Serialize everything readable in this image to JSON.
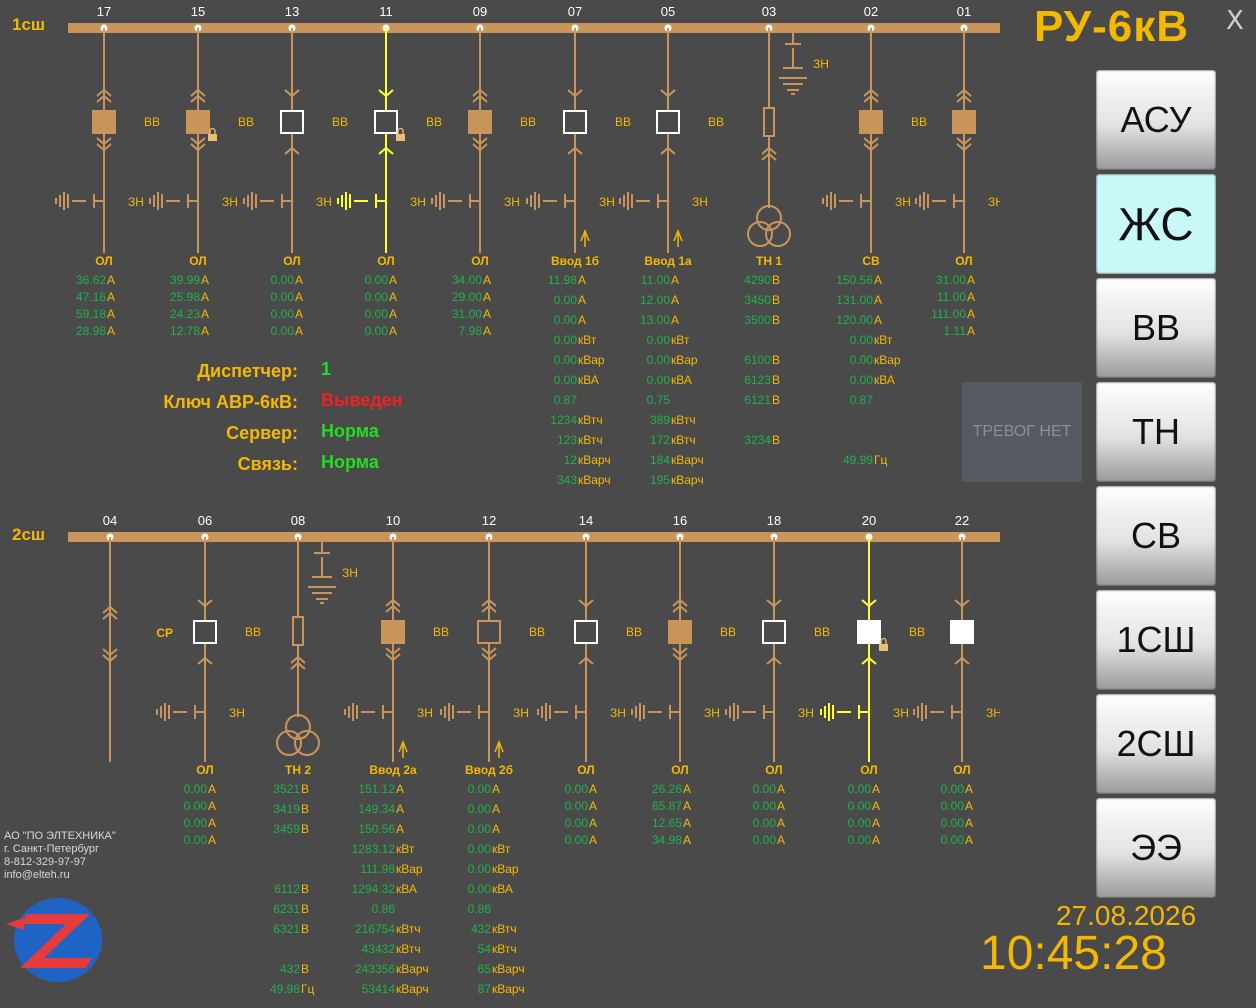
{
  "header": {
    "title": "РУ-6кВ",
    "close": "X"
  },
  "nav": [
    {
      "label": "АСУ",
      "active": false
    },
    {
      "label": "ЖС",
      "active": true
    },
    {
      "label": "ВВ",
      "active": false
    },
    {
      "label": "ТН",
      "active": false
    },
    {
      "label": "СВ",
      "active": false
    },
    {
      "label": "1СШ",
      "active": false
    },
    {
      "label": "2СШ",
      "active": false
    },
    {
      "label": "ЭЭ",
      "active": false
    }
  ],
  "alarm": "ТРЕВОГ НЕТ",
  "company": [
    "АО \"ПО ЭЛТЕХНИКА\"",
    "г. Санкт-Петербург",
    "8-812-329-97-97",
    "info@elteh.ru"
  ],
  "clock": {
    "date": "27.08.2026",
    "time": "10:45:28"
  },
  "status": [
    {
      "label": "Диспетчер:",
      "value": "1",
      "color": "#22dd22"
    },
    {
      "label": "Ключ АВР-6кВ:",
      "value": "Выведен",
      "color": "#ee2222"
    },
    {
      "label": "Сервер:",
      "value": "Норма",
      "color": "#22dd22"
    },
    {
      "label": "Связь:",
      "value": "Норма",
      "color": "#22dd22"
    }
  ],
  "bus1": {
    "label": "1сш",
    "cells": [
      {
        "num": "17",
        "type": "feeder",
        "breaker": "filled",
        "lock": false,
        "live": false,
        "name": "ОЛ",
        "values": [
          [
            "36.62",
            "А"
          ],
          [
            "47.16",
            "А"
          ],
          [
            "59.18",
            "А"
          ],
          [
            "28.98",
            "А"
          ]
        ]
      },
      {
        "num": "15",
        "type": "feeder",
        "breaker": "filled",
        "lock": true,
        "live": false,
        "name": "ОЛ",
        "values": [
          [
            "39.99",
            "А"
          ],
          [
            "25.98",
            "А"
          ],
          [
            "24.23",
            "А"
          ],
          [
            "12.78",
            "А"
          ]
        ]
      },
      {
        "num": "13",
        "type": "feeder",
        "breaker": "open",
        "lock": false,
        "live": false,
        "name": "ОЛ",
        "values": [
          [
            "0.00",
            "А"
          ],
          [
            "0.00",
            "А"
          ],
          [
            "0.00",
            "А"
          ],
          [
            "0.00",
            "А"
          ]
        ]
      },
      {
        "num": "11",
        "type": "feeder",
        "breaker": "open",
        "lock": true,
        "live": true,
        "name": "ОЛ",
        "values": [
          [
            "0.00",
            "А"
          ],
          [
            "0.00",
            "А"
          ],
          [
            "0.00",
            "А"
          ],
          [
            "0.00",
            "А"
          ]
        ]
      },
      {
        "num": "09",
        "type": "feeder",
        "breaker": "filled",
        "lock": false,
        "live": false,
        "name": "ОЛ",
        "values": [
          [
            "34.00",
            "А"
          ],
          [
            "29.00",
            "А"
          ],
          [
            "31.00",
            "А"
          ],
          [
            "7.98",
            "А"
          ]
        ]
      },
      {
        "num": "07",
        "type": "input",
        "breaker": "open",
        "lock": false,
        "live": false,
        "name": "Ввод 1б",
        "values": [
          [
            "11.98",
            "А"
          ],
          [
            "0.00",
            "А"
          ],
          [
            "0.00",
            "А"
          ],
          [
            "0.00",
            "кВт"
          ],
          [
            "0.00",
            "кВар"
          ],
          [
            "0.00",
            "кВА"
          ],
          [
            "0.87",
            ""
          ],
          [
            "1234",
            "кВтч"
          ],
          [
            "123",
            "кВтч"
          ],
          [
            "12",
            "кВарч"
          ],
          [
            "343",
            "кВарч"
          ]
        ]
      },
      {
        "num": "05",
        "type": "input",
        "breaker": "open",
        "lock": false,
        "live": false,
        "name": "Ввод 1а",
        "values": [
          [
            "11.00",
            "А"
          ],
          [
            "12.00",
            "А"
          ],
          [
            "13.00",
            "А"
          ],
          [
            "0.00",
            "кВт"
          ],
          [
            "0.00",
            "кВар"
          ],
          [
            "0.00",
            "кВА"
          ],
          [
            "0.75",
            "",
            true
          ],
          [
            "389",
            "кВтч"
          ],
          [
            "172",
            "кВтч"
          ],
          [
            "184",
            "кВарч"
          ],
          [
            "195",
            "кВарч"
          ]
        ]
      },
      {
        "num": "03",
        "type": "tn",
        "name": "ТН 1",
        "values": [
          [
            "4290",
            "В",
            "#ee3333"
          ],
          [
            "3450",
            "В"
          ],
          [
            "3500",
            "В"
          ],
          [
            "",
            ""
          ],
          [
            "6100",
            "В"
          ],
          [
            "6123",
            "В"
          ],
          [
            "6121",
            "В"
          ],
          [
            "",
            ""
          ],
          [
            "3234",
            "В",
            "#ee3333"
          ]
        ]
      },
      {
        "num": "02",
        "type": "sv",
        "breaker": "filled",
        "lock": false,
        "live": false,
        "name": "СВ",
        "values": [
          [
            "150.56",
            "А"
          ],
          [
            "131.00",
            "А"
          ],
          [
            "120.00",
            "А"
          ],
          [
            "0.00",
            "кВт"
          ],
          [
            "0.00",
            "кВар"
          ],
          [
            "0.00",
            "кВА"
          ],
          [
            "0.87",
            ""
          ],
          [
            "",
            ""
          ],
          [
            "",
            ""
          ],
          [
            "49.99",
            "Гц"
          ]
        ]
      },
      {
        "num": "01",
        "type": "feeder",
        "breaker": "filled",
        "lock": false,
        "live": false,
        "name": "ОЛ",
        "values": [
          [
            "31.00",
            "А"
          ],
          [
            "11.00",
            "А"
          ],
          [
            "111.00",
            "А"
          ],
          [
            "1.11",
            "А"
          ]
        ]
      }
    ]
  },
  "bus2": {
    "label": "2сш",
    "cells": [
      {
        "num": "04",
        "type": "cable",
        "name": "",
        "values": []
      },
      {
        "num": "06",
        "type": "feeder",
        "breaker": "open",
        "lock": false,
        "live": false,
        "name": "ОЛ",
        "extra": "СР",
        "values": [
          [
            "0.00",
            "А"
          ],
          [
            "0.00",
            "А"
          ],
          [
            "0.00",
            "А"
          ],
          [
            "0.00",
            "А"
          ]
        ]
      },
      {
        "num": "08",
        "type": "tn",
        "name": "ТН 2",
        "values": [
          [
            "3521",
            "В"
          ],
          [
            "3419",
            "В"
          ],
          [
            "3459",
            "В"
          ],
          [
            "",
            ""
          ],
          [
            "",
            ""
          ],
          [
            "6112",
            "В"
          ],
          [
            "6231",
            "В"
          ],
          [
            "6321",
            "В",
            "#dd22dd"
          ],
          [
            "",
            ""
          ],
          [
            "432",
            "В"
          ],
          [
            "49.98",
            "Гц"
          ]
        ]
      },
      {
        "num": "10",
        "type": "input",
        "breaker": "filled",
        "lock": false,
        "live": false,
        "name": "Ввод 2а",
        "values": [
          [
            "151.12",
            "А"
          ],
          [
            "149.34",
            "А"
          ],
          [
            "150.56",
            "А"
          ],
          [
            "1283.12",
            "кВт"
          ],
          [
            "111.98",
            "кВар"
          ],
          [
            "1294.32",
            "кВА"
          ],
          [
            "0.86",
            ""
          ],
          [
            "216754",
            "кВтч"
          ],
          [
            "43432",
            "кВтч"
          ],
          [
            "243356",
            "кВарч"
          ],
          [
            "53414",
            "кВарч"
          ]
        ]
      },
      {
        "num": "12",
        "type": "input",
        "breaker": "outline",
        "lock": false,
        "live": false,
        "name": "Ввод 2б",
        "values": [
          [
            "0.00",
            "А"
          ],
          [
            "0.00",
            "А"
          ],
          [
            "0.00",
            "А"
          ],
          [
            "0.00",
            "кВт"
          ],
          [
            "0.00",
            "кВар"
          ],
          [
            "0.00",
            "кВА"
          ],
          [
            "0.86",
            ""
          ],
          [
            "432",
            "кВтч"
          ],
          [
            "54",
            "кВтч"
          ],
          [
            "65",
            "кВарч"
          ],
          [
            "87",
            "кВарч"
          ]
        ]
      },
      {
        "num": "14",
        "type": "feeder",
        "breaker": "open",
        "lock": false,
        "live": false,
        "name": "ОЛ",
        "values": [
          [
            "0.00",
            "А"
          ],
          [
            "0.00",
            "А"
          ],
          [
            "0.00",
            "А"
          ],
          [
            "0.00",
            "А"
          ]
        ]
      },
      {
        "num": "16",
        "type": "feeder",
        "breaker": "filled",
        "lock": false,
        "live": false,
        "name": "ОЛ",
        "values": [
          [
            "26.26",
            "А"
          ],
          [
            "65.87",
            "А"
          ],
          [
            "12.65",
            "А"
          ],
          [
            "34.98",
            "А"
          ]
        ]
      },
      {
        "num": "18",
        "type": "feeder",
        "breaker": "open",
        "lock": false,
        "live": false,
        "name": "ОЛ",
        "values": [
          [
            "0.00",
            "А"
          ],
          [
            "0.00",
            "А"
          ],
          [
            "0.00",
            "А"
          ],
          [
            "0.00",
            "А"
          ]
        ]
      },
      {
        "num": "20",
        "type": "feeder",
        "breaker": "white",
        "lock": true,
        "live": true,
        "name": "ОЛ",
        "values": [
          [
            "0.00",
            "А"
          ],
          [
            "0.00",
            "А"
          ],
          [
            "0.00",
            "А"
          ],
          [
            "0.00",
            "А"
          ]
        ]
      },
      {
        "num": "22",
        "type": "feeder",
        "breaker": "white",
        "lock": false,
        "live": false,
        "name": "ОЛ",
        "values": [
          [
            "0.00",
            "А"
          ],
          [
            "0.00",
            "А"
          ],
          [
            "0.00",
            "А"
          ],
          [
            "0.00",
            "А"
          ]
        ]
      }
    ]
  },
  "labels": {
    "breaker": "ВВ",
    "earth": "ЗН"
  },
  "colors": {
    "bus": "#c9955a",
    "element": "#c9955a",
    "live": "#ffff33",
    "text": "#f5b800",
    "value": "#1fb24a"
  }
}
